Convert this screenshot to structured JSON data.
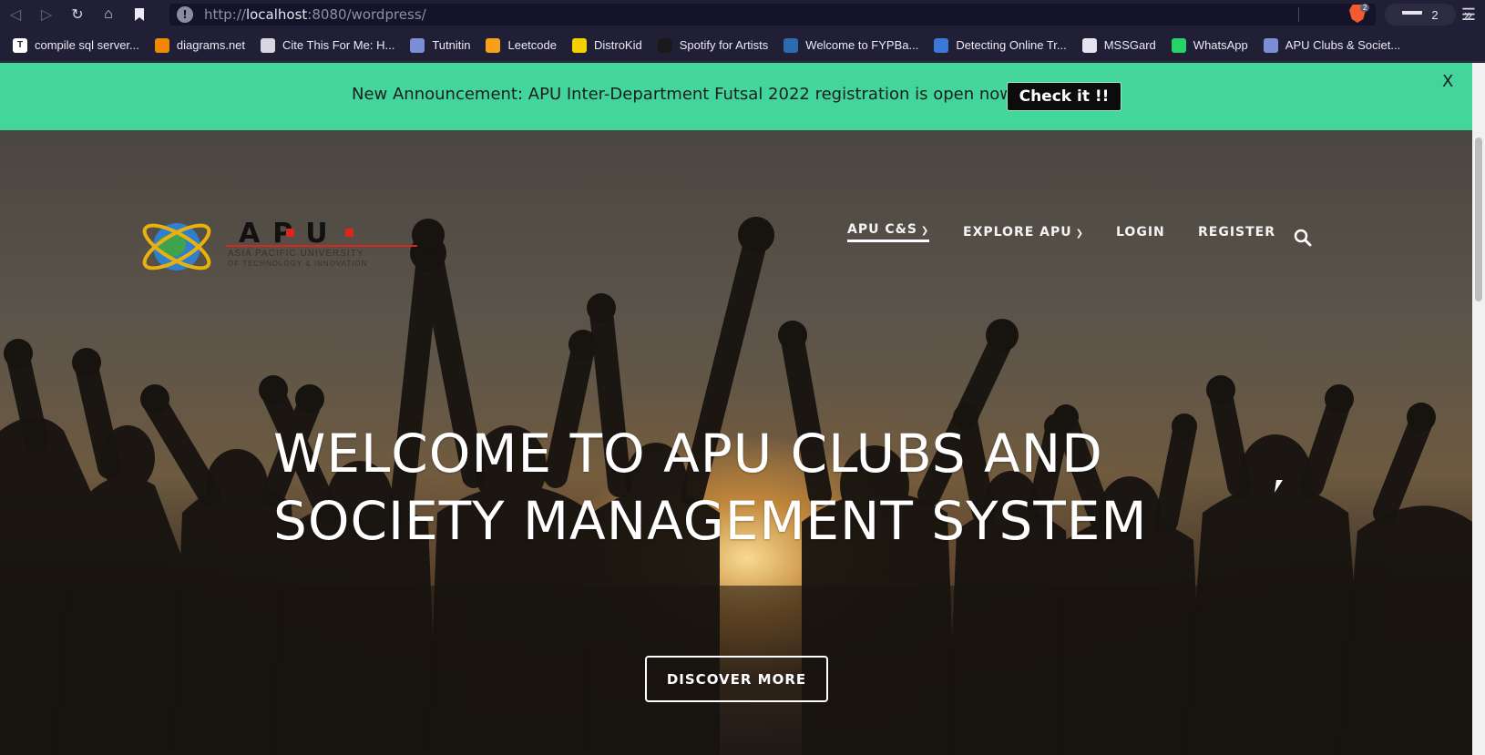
{
  "browser": {
    "url_scheme": "http://",
    "url_host": "localhost",
    "url_rest": ":8080/wordpress/",
    "brave_count": "2",
    "ext_count": "2"
  },
  "bookmarks": [
    {
      "label": "compile sql server...",
      "icon": "T",
      "color": "#ffffff",
      "fg": "#201f35"
    },
    {
      "label": "diagrams.net",
      "icon": "",
      "color": "#f08705",
      "fg": "#ffffff"
    },
    {
      "label": "Cite This For Me: H...",
      "icon": "",
      "color": "#d7d6e0",
      "fg": "#201f35"
    },
    {
      "label": "Tutnitin",
      "icon": "",
      "color": "#7a8fd6",
      "fg": "#ffffff"
    },
    {
      "label": "Leetcode",
      "icon": "",
      "color": "#f89f1b",
      "fg": "#ffffff"
    },
    {
      "label": "DistroKid",
      "icon": "",
      "color": "#f5d000",
      "fg": "#ffffff"
    },
    {
      "label": "Spotify for Artists",
      "icon": "",
      "color": "#1a1a1a",
      "fg": "#ffffff"
    },
    {
      "label": "Welcome to FYPBa...",
      "icon": "",
      "color": "#2b6cb0",
      "fg": "#ffffff"
    },
    {
      "label": "Detecting Online Tr...",
      "icon": "",
      "color": "#3c78d8",
      "fg": "#ffffff"
    },
    {
      "label": "MSSGard",
      "icon": "",
      "color": "#e6e5ef",
      "fg": "#201f35"
    },
    {
      "label": "WhatsApp",
      "icon": "",
      "color": "#25d366",
      "fg": "#ffffff"
    },
    {
      "label": "APU Clubs & Societ...",
      "icon": "",
      "color": "#7a8fd6",
      "fg": "#ffffff"
    }
  ],
  "announcement": {
    "text": "New Announcement: APU Inter-Department Futsal 2022 registration is open now!!",
    "button": "Check it !!",
    "close": "X"
  },
  "logo": {
    "letters": "APU",
    "line1": "ASIA PACIFIC UNIVERSITY",
    "line2": "OF TECHNOLOGY & INNOVATION"
  },
  "nav": {
    "item1": "APU C&S",
    "item2": "EXPLORE APU",
    "item3": "LOGIN",
    "item4": "REGISTER"
  },
  "hero": {
    "title_line1": "WELCOME TO APU CLUBS AND",
    "title_line2": "SOCIETY MANAGEMENT SYSTEM",
    "button": "DISCOVER MORE"
  },
  "colors": {
    "announcement_bg": "#42d69a",
    "chrome_bg": "#201f35"
  }
}
